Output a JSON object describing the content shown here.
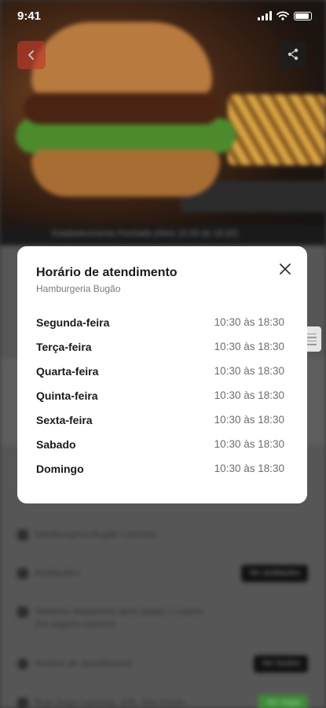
{
  "status_bar": {
    "time": "9:41"
  },
  "hours_modal": {
    "title": "Horário de atendimento",
    "subtitle": "Hamburgeria Bugão",
    "rows": [
      {
        "day": "Segunda-feira",
        "hours": "10:30 às 18:30"
      },
      {
        "day": "Terça-feira",
        "hours": "10:30 às 18:30"
      },
      {
        "day": "Quarta-feira",
        "hours": "10:30 às 18:30"
      },
      {
        "day": "Quinta-feira",
        "hours": "10:30 às 18:30"
      },
      {
        "day": "Sexta-feira",
        "hours": "10:30 às 18:30"
      },
      {
        "day": "Sabado",
        "hours": "10:30 às 18:30"
      },
      {
        "day": "Domingo",
        "hours": "10:30 às 18:30"
      }
    ]
  },
  "background": {
    "closed_notice": "Estabelecimento Fechado (Abre 10:30 às 18:30)",
    "store_name": "Hamburgeria Bugão Lanches",
    "reviews_label": "Avaliações",
    "reviews_button": "Ver avaliações",
    "phone_note_line1": "Telefone disponível após pegar o cupom",
    "phone_note_line2": "(na página cupons)",
    "hours_label": "Horário de atendimento",
    "hours_button": "Ver horário",
    "address": "Rua Jorge Lacerda, 100, São Paulo",
    "map_button": "Ver mapa"
  },
  "icons": {
    "back": "arrow-left-icon",
    "share": "share-icon",
    "close": "close-icon",
    "handle": "menu-handle-icon"
  },
  "colors": {
    "accent_red": "#c0392b",
    "action_green": "#3e8a3a"
  }
}
